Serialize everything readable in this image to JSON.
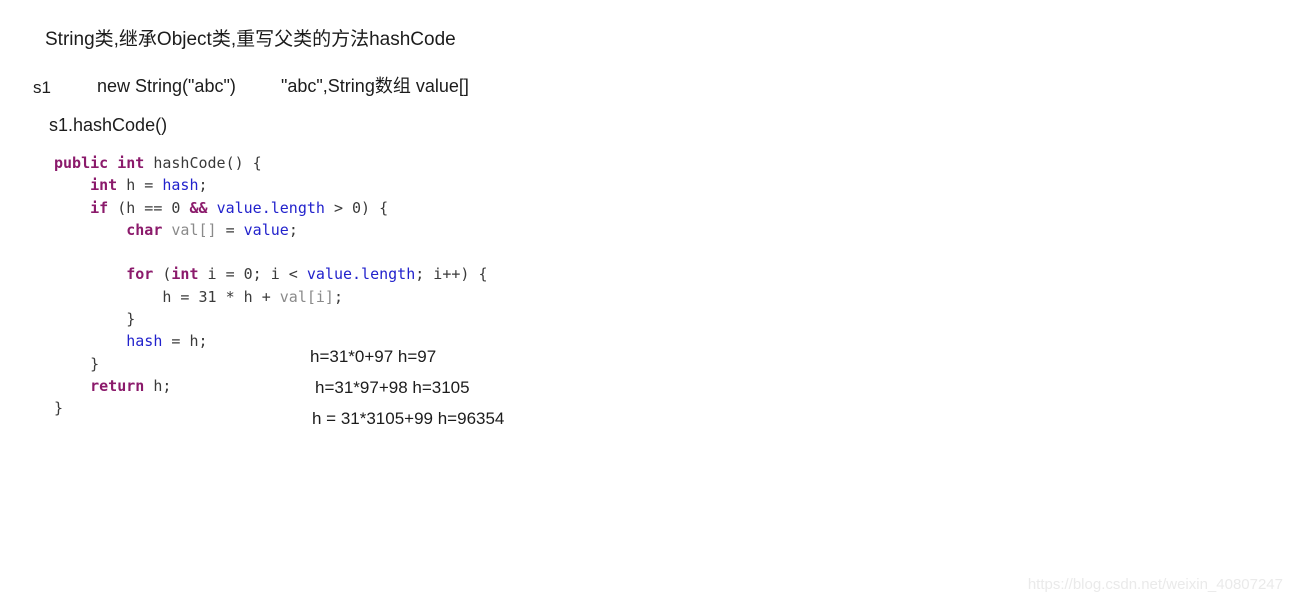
{
  "page": {
    "background": "#ffffff",
    "title": "String类,继承Object类,重写父类的方法hashCode"
  },
  "notes": {
    "variable": "s1",
    "expression": "new String(\"abc\")",
    "value_note": "\"abc\",String数组 value[]",
    "call": "s1.hashCode()"
  },
  "code": {
    "language": "java",
    "colors": {
      "keyword": "#8b1a6b",
      "field": "#2222cc",
      "gray": "#8a8a8a",
      "plain": "#3a3a3a"
    },
    "lines": [
      {
        "tokens": [
          {
            "t": "public",
            "c": "kw"
          },
          {
            "t": " ",
            "c": "pln"
          },
          {
            "t": "int",
            "c": "kw"
          },
          {
            "t": " hashCode() {",
            "c": "pln"
          }
        ]
      },
      {
        "tokens": [
          {
            "t": "    ",
            "c": "pln"
          },
          {
            "t": "int",
            "c": "kw"
          },
          {
            "t": " h = ",
            "c": "pln"
          },
          {
            "t": "hash",
            "c": "fld"
          },
          {
            "t": ";",
            "c": "pln"
          }
        ]
      },
      {
        "tokens": [
          {
            "t": "    ",
            "c": "pln"
          },
          {
            "t": "if",
            "c": "kw"
          },
          {
            "t": " (h == 0 ",
            "c": "pln"
          },
          {
            "t": "&&",
            "c": "kw"
          },
          {
            "t": " ",
            "c": "pln"
          },
          {
            "t": "value.length",
            "c": "fld"
          },
          {
            "t": " > 0) {",
            "c": "pln"
          }
        ]
      },
      {
        "tokens": [
          {
            "t": "        ",
            "c": "pln"
          },
          {
            "t": "char",
            "c": "kw"
          },
          {
            "t": " ",
            "c": "pln"
          },
          {
            "t": "val[]",
            "c": "gry"
          },
          {
            "t": " = ",
            "c": "pln"
          },
          {
            "t": "value",
            "c": "fld"
          },
          {
            "t": ";",
            "c": "pln"
          }
        ]
      },
      {
        "tokens": []
      },
      {
        "tokens": [
          {
            "t": "        ",
            "c": "pln"
          },
          {
            "t": "for",
            "c": "kw"
          },
          {
            "t": " (",
            "c": "pln"
          },
          {
            "t": "int",
            "c": "kw"
          },
          {
            "t": " i = 0; i < ",
            "c": "pln"
          },
          {
            "t": "value.length",
            "c": "fld"
          },
          {
            "t": "; i++) {",
            "c": "pln"
          }
        ]
      },
      {
        "tokens": [
          {
            "t": "            h = 31 * h + ",
            "c": "pln"
          },
          {
            "t": "val[i]",
            "c": "gry"
          },
          {
            "t": ";",
            "c": "pln"
          }
        ]
      },
      {
        "tokens": [
          {
            "t": "        }",
            "c": "pln"
          }
        ]
      },
      {
        "tokens": [
          {
            "t": "        ",
            "c": "pln"
          },
          {
            "t": "hash",
            "c": "fld"
          },
          {
            "t": " = h;",
            "c": "pln"
          }
        ]
      },
      {
        "tokens": [
          {
            "t": "    }",
            "c": "pln"
          }
        ]
      },
      {
        "tokens": [
          {
            "t": "    ",
            "c": "pln"
          },
          {
            "t": "return",
            "c": "kw"
          },
          {
            "t": " h;",
            "c": "pln"
          }
        ]
      },
      {
        "tokens": [
          {
            "t": "}",
            "c": "pln"
          }
        ]
      }
    ]
  },
  "annotations": [
    "h=31*0+97  h=97",
    "h=31*97+98  h=3105",
    "h = 31*3105+99  h=96354"
  ],
  "watermark": {
    "text": "https://blog.csdn.net/weixin_40807247",
    "color": "#eaeaea"
  }
}
